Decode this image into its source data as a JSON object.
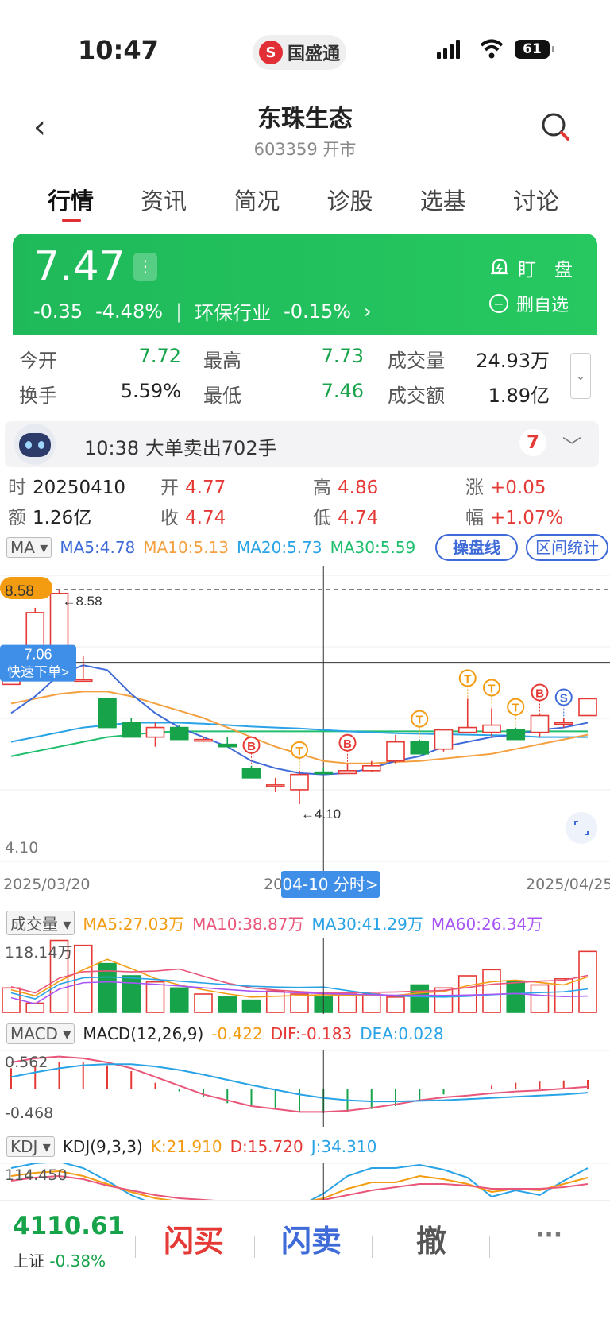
{
  "status": {
    "time": "10:47",
    "brand": "国盛通",
    "battery": "61"
  },
  "header": {
    "title": "东珠生态",
    "subtitle": "603359 开市"
  },
  "tabs": [
    "行情",
    "资讯",
    "简况",
    "诊股",
    "选基",
    "讨论"
  ],
  "quote": {
    "price": "7.47",
    "change": "-0.35",
    "change_pct": "-4.48%",
    "industry": "环保行业",
    "industry_pct": "-0.15%",
    "watch_label": "盯　盘",
    "remove_label": "删自选"
  },
  "stats": {
    "open_label": "今开",
    "open": "7.72",
    "high_label": "最高",
    "high": "7.73",
    "volume_label": "成交量",
    "volume": "24.93万",
    "turnover_label": "换手",
    "turnover": "5.59%",
    "low_label": "最低",
    "low": "7.46",
    "amount_label": "成交额",
    "amount": "1.89亿"
  },
  "news": {
    "text": "10:38 大单卖出702手",
    "count": "7"
  },
  "dayinfo": {
    "date_label": "时",
    "date": "20250410",
    "open_label": "开",
    "open": "4.77",
    "high_label": "高",
    "high": "4.86",
    "rise_label": "涨",
    "rise": "+0.05",
    "amount_label": "额",
    "amount": "1.26亿",
    "close_label": "收",
    "close": "4.74",
    "low_label": "低",
    "low": "4.74",
    "range_label": "幅",
    "range": "+1.07%"
  },
  "ma_legend": {
    "selector": "MA ▾",
    "ma5": "MA5:4.78",
    "ma10": "MA10:5.13",
    "ma20": "MA20:5.73",
    "ma30": "MA30:5.59",
    "btn_ops": "操盘线",
    "btn_range": "区间统计"
  },
  "chart_labels": {
    "top_price": "8.58",
    "max_marker": "←8.58",
    "quick_price": "7.06",
    "quick_order": "快速下单>",
    "bottom_price": "4.10",
    "min_marker": "←4.10",
    "date_start": "2025/03/20",
    "date_mid": "20",
    "date_tooltip": "04-10 分时>",
    "date_end": "2025/04/25"
  },
  "vol_legend": {
    "selector": "成交量 ▾",
    "ma5": "MA5:27.03万",
    "ma10": "MA10:38.87万",
    "ma30": "MA30:41.29万",
    "ma60": "MA60:26.34万",
    "max_label": "118.14万"
  },
  "macd_legend": {
    "selector": "MACD ▾",
    "params": "MACD(12,26,9)",
    "macd": "-0.422",
    "dif": "DIF:-0.183",
    "dea": "DEA:0.028",
    "top": "0.562",
    "bottom": "-0.468"
  },
  "kdj_legend": {
    "selector": "KDJ ▾",
    "params": "KDJ(9,3,3)",
    "k": "K:21.910",
    "d": "D:15.720",
    "j": "J:34.310",
    "top": "114.450"
  },
  "bottom": {
    "index_value": "4110.61",
    "index_name": "上证",
    "index_pct": "-0.38%",
    "buy": "闪买",
    "sell": "闪卖",
    "cancel": "撤",
    "more": "···"
  },
  "colors": {
    "up": "#e53935",
    "down": "#16a34a",
    "accent": "#3f6bd8",
    "ma5": "#3f6bd8",
    "ma10": "#f4a040",
    "ma20": "#29a3e6",
    "ma30": "#1fbf6e"
  },
  "chart_data": {
    "type": "candlestick",
    "ylim": [
      4.1,
      8.58
    ],
    "candles": [
      {
        "o": 6.6,
        "c": 7.3,
        "h": 7.4,
        "l": 6.6
      },
      {
        "o": 7.3,
        "c": 8.1,
        "h": 8.2,
        "l": 7.3
      },
      {
        "o": 6.9,
        "c": 8.5,
        "h": 8.58,
        "l": 6.9
      },
      {
        "o": 6.7,
        "c": 6.7,
        "h": 7.2,
        "l": 6.7
      },
      {
        "o": 6.3,
        "c": 5.7,
        "h": 6.3,
        "l": 5.7
      },
      {
        "o": 5.8,
        "c": 5.5,
        "h": 5.9,
        "l": 5.5
      },
      {
        "o": 5.5,
        "c": 5.7,
        "h": 5.8,
        "l": 5.3
      },
      {
        "o": 5.7,
        "c": 5.45,
        "h": 5.75,
        "l": 5.45
      },
      {
        "o": 5.45,
        "c": 5.45,
        "h": 5.5,
        "l": 5.4
      },
      {
        "o": 5.35,
        "c": 5.3,
        "h": 5.5,
        "l": 5.3
      },
      {
        "o": 4.85,
        "c": 4.65,
        "h": 4.9,
        "l": 4.65
      },
      {
        "o": 4.5,
        "c": 4.5,
        "h": 4.65,
        "l": 4.35
      },
      {
        "o": 4.4,
        "c": 4.72,
        "h": 4.8,
        "l": 4.1
      },
      {
        "o": 4.77,
        "c": 4.74,
        "h": 4.86,
        "l": 4.74
      },
      {
        "o": 4.74,
        "c": 4.8,
        "h": 4.95,
        "l": 4.74
      },
      {
        "o": 4.8,
        "c": 4.9,
        "h": 5.0,
        "l": 4.78
      },
      {
        "o": 5.0,
        "c": 5.4,
        "h": 5.55,
        "l": 4.95
      },
      {
        "o": 5.4,
        "c": 5.15,
        "h": 5.45,
        "l": 5.15
      },
      {
        "o": 5.25,
        "c": 5.65,
        "h": 5.65,
        "l": 5.2
      },
      {
        "o": 5.6,
        "c": 5.7,
        "h": 6.3,
        "l": 5.6
      },
      {
        "o": 5.6,
        "c": 5.75,
        "h": 6.1,
        "l": 5.5
      },
      {
        "o": 5.65,
        "c": 5.45,
        "h": 5.7,
        "l": 5.45
      },
      {
        "o": 5.6,
        "c": 5.95,
        "h": 6.0,
        "l": 5.5
      },
      {
        "o": 5.8,
        "c": 5.8,
        "h": 5.9,
        "l": 5.7
      },
      {
        "o": 5.95,
        "c": 6.3,
        "h": 6.3,
        "l": 5.95
      }
    ],
    "ma5": [
      6.0,
      6.35,
      6.8,
      7.0,
      6.9,
      6.4,
      6.0,
      5.7,
      5.5,
      5.3,
      5.0,
      4.85,
      4.75,
      4.72,
      4.75,
      4.85,
      5.0,
      5.1,
      5.3,
      5.4,
      5.5,
      5.55,
      5.65,
      5.7,
      5.8
    ],
    "ma10": [
      6.2,
      6.3,
      6.4,
      6.45,
      6.45,
      6.35,
      6.2,
      6.05,
      5.9,
      5.7,
      5.5,
      5.3,
      5.15,
      5.0,
      4.95,
      4.95,
      4.98,
      5.0,
      5.05,
      5.1,
      5.15,
      5.25,
      5.35,
      5.45,
      5.55
    ],
    "ma20": [
      5.4,
      5.5,
      5.6,
      5.7,
      5.75,
      5.8,
      5.8,
      5.8,
      5.78,
      5.75,
      5.72,
      5.7,
      5.68,
      5.65,
      5.62,
      5.6,
      5.58,
      5.57,
      5.56,
      5.55,
      5.54,
      5.53,
      5.5,
      5.5,
      5.5
    ],
    "ma30": [
      5.1,
      5.2,
      5.3,
      5.4,
      5.5,
      5.55,
      5.6,
      5.62,
      5.62,
      5.62,
      5.62,
      5.62,
      5.62,
      5.62,
      5.62,
      5.62,
      5.62,
      5.62,
      5.62,
      5.62,
      5.62,
      5.62,
      5.62,
      5.62,
      5.62
    ],
    "signals": [
      {
        "i": 10,
        "t": "B",
        "color": "#e53935"
      },
      {
        "i": 12,
        "t": "T",
        "color": "#f39c12"
      },
      {
        "i": 14,
        "t": "B",
        "color": "#e53935"
      },
      {
        "i": 17,
        "t": "T",
        "color": "#f39c12"
      },
      {
        "i": 19,
        "t": "T",
        "color": "#f39c12"
      },
      {
        "i": 20,
        "t": "T",
        "color": "#f39c12"
      },
      {
        "i": 21,
        "t": "T",
        "color": "#f39c12"
      },
      {
        "i": 22,
        "t": "B",
        "color": "#e53935"
      },
      {
        "i": 23,
        "t": "S",
        "color": "#3f6bd8"
      }
    ],
    "volume": [
      40,
      15,
      118,
      110,
      80,
      60,
      50,
      40,
      30,
      25,
      20,
      35,
      30,
      25,
      30,
      30,
      25,
      45,
      40,
      60,
      70,
      50,
      45,
      55,
      100
    ],
    "macd_hist": [
      0.35,
      0.4,
      0.45,
      0.45,
      0.4,
      0.3,
      0.1,
      -0.05,
      -0.15,
      -0.25,
      -0.3,
      -0.35,
      -0.4,
      -0.42,
      -0.4,
      -0.35,
      -0.3,
      -0.2,
      -0.1,
      0.0,
      0.05,
      0.1,
      0.12,
      0.14,
      0.15
    ],
    "dif": [
      0.45,
      0.52,
      0.55,
      0.52,
      0.45,
      0.35,
      0.2,
      0.05,
      -0.1,
      -0.2,
      -0.3,
      -0.35,
      -0.4,
      -0.4,
      -0.38,
      -0.33,
      -0.27,
      -0.2,
      -0.15,
      -0.12,
      -0.08,
      -0.05,
      -0.03,
      0.0,
      0.03
    ],
    "dea": [
      0.2,
      0.28,
      0.35,
      0.4,
      0.42,
      0.42,
      0.38,
      0.32,
      0.24,
      0.15,
      0.06,
      -0.02,
      -0.1,
      -0.16,
      -0.2,
      -0.22,
      -0.22,
      -0.21,
      -0.2,
      -0.18,
      -0.16,
      -0.14,
      -0.12,
      -0.1,
      -0.07
    ]
  }
}
